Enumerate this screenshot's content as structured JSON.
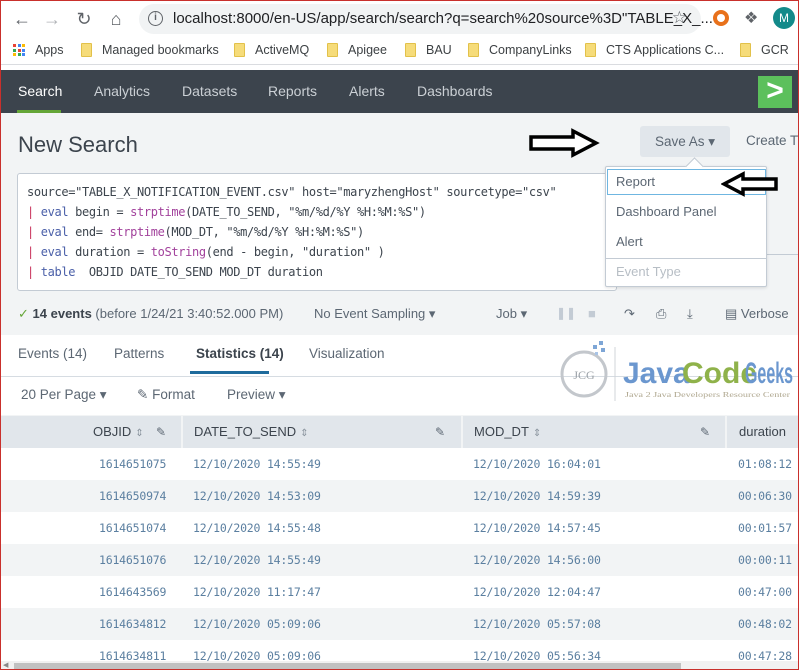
{
  "browser": {
    "url": "localhost:8000/en-US/app/search/search?q=search%20source%3D\"TABLE_X_...",
    "profile_initial": "M",
    "bookmarks": [
      {
        "label": "Apps",
        "icon": "apps-grid-icon"
      },
      {
        "label": "Managed bookmarks",
        "icon": "folder-icon"
      },
      {
        "label": "ActiveMQ",
        "icon": "folder-icon"
      },
      {
        "label": "Apigee",
        "icon": "folder-icon"
      },
      {
        "label": "BAU",
        "icon": "folder-icon"
      },
      {
        "label": "CompanyLinks",
        "icon": "folder-icon"
      },
      {
        "label": "CTS Applications C...",
        "icon": "folder-icon"
      },
      {
        "label": "GCR",
        "icon": "folder-icon"
      }
    ]
  },
  "appbar": {
    "items": [
      {
        "label": "Search",
        "active": true
      },
      {
        "label": "Analytics"
      },
      {
        "label": "Datasets"
      },
      {
        "label": "Reports"
      },
      {
        "label": "Alerts"
      },
      {
        "label": "Dashboards"
      }
    ],
    "logo_glyph": ">",
    "accent": "#65a637"
  },
  "header": {
    "title": "New Search",
    "save_as_label": "Save As ▾",
    "create_label": "Create T"
  },
  "search": {
    "lines": [
      {
        "pipe": "",
        "kw": "",
        "text": "source=\"TABLE_X_NOTIFICATION_EVENT.csv\" host=\"maryzhengHost\" sourcetype=\"csv\""
      },
      {
        "pipe": "| ",
        "kw": "eval",
        "pre": " begin = ",
        "fn": "strptime",
        "post": "(DATE_TO_SEND, \"%m/%d/%Y %H:%M:%S\")"
      },
      {
        "pipe": "| ",
        "kw": "eval",
        "pre": " end= ",
        "fn": "strptime",
        "post": "(MOD_DT, \"%m/%d/%Y %H:%M:%S\")"
      },
      {
        "pipe": "| ",
        "kw": "eval",
        "pre": " duration = ",
        "fn": "toString",
        "post": "(end - begin, \"duration\" )"
      },
      {
        "pipe": "| ",
        "kw": "table",
        "pre": "  OBJID DATE_TO_SEND MOD_DT duration",
        "fn": "",
        "post": ""
      }
    ]
  },
  "save_as_menu": {
    "items": [
      {
        "label": "Report",
        "highlighted": true
      },
      {
        "label": "Dashboard Panel"
      },
      {
        "label": "Alert"
      },
      {
        "label": "Event Type",
        "disabled": true
      }
    ]
  },
  "status": {
    "check": "✓",
    "count": "14 events",
    "detail": "(before 1/24/21 3:40:52.000 PM)",
    "sampling": "No Event Sampling ▾",
    "job": "Job ▾",
    "mode": "Verbose"
  },
  "tabs": [
    {
      "label": "Events (14)"
    },
    {
      "label": "Patterns"
    },
    {
      "label": "Statistics (14)",
      "active": true
    },
    {
      "label": "Visualization"
    }
  ],
  "options": {
    "per_page": "20 Per Page ▾",
    "format": "Format",
    "preview": "Preview ▾"
  },
  "watermark": {
    "badge": "JCG",
    "title_a": "Java",
    "title_b": "Code",
    "title_c": "Geeks",
    "subtitle": "Java 2 Java Developers Resource Center"
  },
  "table": {
    "columns": [
      "OBJID",
      "DATE_TO_SEND",
      "MOD_DT",
      "duration"
    ],
    "rows": [
      [
        "1614651075",
        "12/10/2020 14:55:49",
        "12/10/2020 16:04:01",
        "01:08:12"
      ],
      [
        "1614650974",
        "12/10/2020 14:53:09",
        "12/10/2020 14:59:39",
        "00:06:30"
      ],
      [
        "1614651074",
        "12/10/2020 14:55:48",
        "12/10/2020 14:57:45",
        "00:01:57"
      ],
      [
        "1614651076",
        "12/10/2020 14:55:49",
        "12/10/2020 14:56:00",
        "00:00:11"
      ],
      [
        "1614643569",
        "12/10/2020 11:17:47",
        "12/10/2020 12:04:47",
        "00:47:00"
      ],
      [
        "1614634812",
        "12/10/2020 05:09:06",
        "12/10/2020 05:57:08",
        "00:48:02"
      ],
      [
        "1614634811",
        "12/10/2020 05:09:06",
        "12/10/2020 05:56:34",
        "00:47:28"
      ]
    ]
  }
}
